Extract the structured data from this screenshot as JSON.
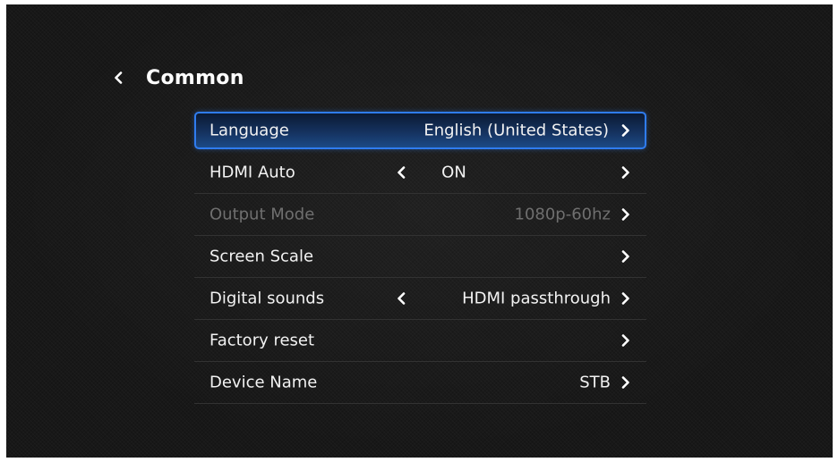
{
  "header": {
    "title": "Common",
    "back_icon": "chevron-left-icon"
  },
  "colors": {
    "selection_border": "#2f7cf0",
    "selection_fill": "#15325f",
    "text": "#f2f2f2",
    "disabled_text": "#6f6f6f",
    "background": "#181818"
  },
  "menu": {
    "items": [
      {
        "label": "Language",
        "value": "English (United States)",
        "selected": true,
        "disabled": false,
        "has_left_arrow": false
      },
      {
        "label": "HDMI Auto",
        "value": "ON",
        "selected": false,
        "disabled": false,
        "has_left_arrow": true
      },
      {
        "label": "Output Mode",
        "value": "1080p-60hz",
        "selected": false,
        "disabled": true,
        "has_left_arrow": false
      },
      {
        "label": "Screen Scale",
        "value": "",
        "selected": false,
        "disabled": false,
        "has_left_arrow": false
      },
      {
        "label": "Digital sounds",
        "value": "HDMI passthrough",
        "selected": false,
        "disabled": false,
        "has_left_arrow": true
      },
      {
        "label": "Factory reset",
        "value": "",
        "selected": false,
        "disabled": false,
        "has_left_arrow": false
      },
      {
        "label": "Device Name",
        "value": "STB",
        "selected": false,
        "disabled": false,
        "has_left_arrow": false
      }
    ]
  }
}
